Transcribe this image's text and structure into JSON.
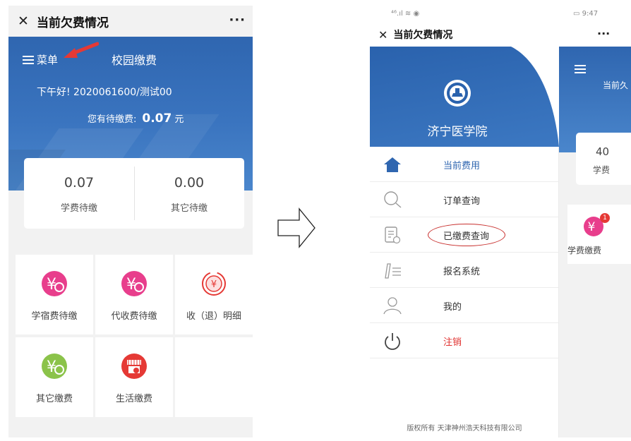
{
  "left": {
    "header": {
      "close_glyph": "✕",
      "title": "当前欠费情况",
      "more_glyph": "···"
    },
    "banner": {
      "menu_label": "菜单",
      "title": "校园缴费",
      "greeting": "下午好! 2020061600/测试00",
      "pending_label": "您有待缴费:",
      "pending_amount": "0.07",
      "pending_unit": "元"
    },
    "summary": [
      {
        "value": "0.07",
        "label": "学费待缴"
      },
      {
        "value": "0.00",
        "label": "其它待缴"
      }
    ],
    "grid": [
      {
        "label": "学宿费待缴",
        "icon": "yuan-icon",
        "color": "#e83e8c"
      },
      {
        "label": "代收费待缴",
        "icon": "yuan-icon",
        "color": "#e83e8c"
      },
      {
        "label": "收（退）明细",
        "icon": "refund-icon",
        "color": "#e53935"
      },
      {
        "label": "其它缴费",
        "icon": "yuan-icon",
        "color": "#8bc34a"
      },
      {
        "label": "生活缴费",
        "icon": "shop-icon",
        "color": "#e53935"
      }
    ]
  },
  "right": {
    "status": {
      "signal": "⁴⁶.ıl ≋ ◉",
      "battery": "▭ 9:47"
    },
    "header": {
      "close_glyph": "✕",
      "title": "当前欠费情况",
      "more_glyph": "···"
    },
    "drawer": {
      "school_name": "济宁医学院",
      "items": [
        {
          "label": "当前费用",
          "icon": "home-icon"
        },
        {
          "label": "订单查询",
          "icon": "search-icon"
        },
        {
          "label": "已缴费查询",
          "icon": "receipt-icon"
        },
        {
          "label": "报名系统",
          "icon": "edit-icon"
        },
        {
          "label": "我的",
          "icon": "user-icon"
        },
        {
          "label": "注销",
          "icon": "power-icon"
        }
      ],
      "copyright": "版权所有 天津神州浩天科技有限公司"
    },
    "behind": {
      "peek_greeting": "当前久",
      "peek_value": "40",
      "peek_label": "学费",
      "badge": "1",
      "peek_tile": "学费缴费"
    }
  },
  "colors": {
    "brand_blue": "#2f66b0",
    "logout_red": "#e0312f",
    "annotation_red": "#c8302e"
  }
}
